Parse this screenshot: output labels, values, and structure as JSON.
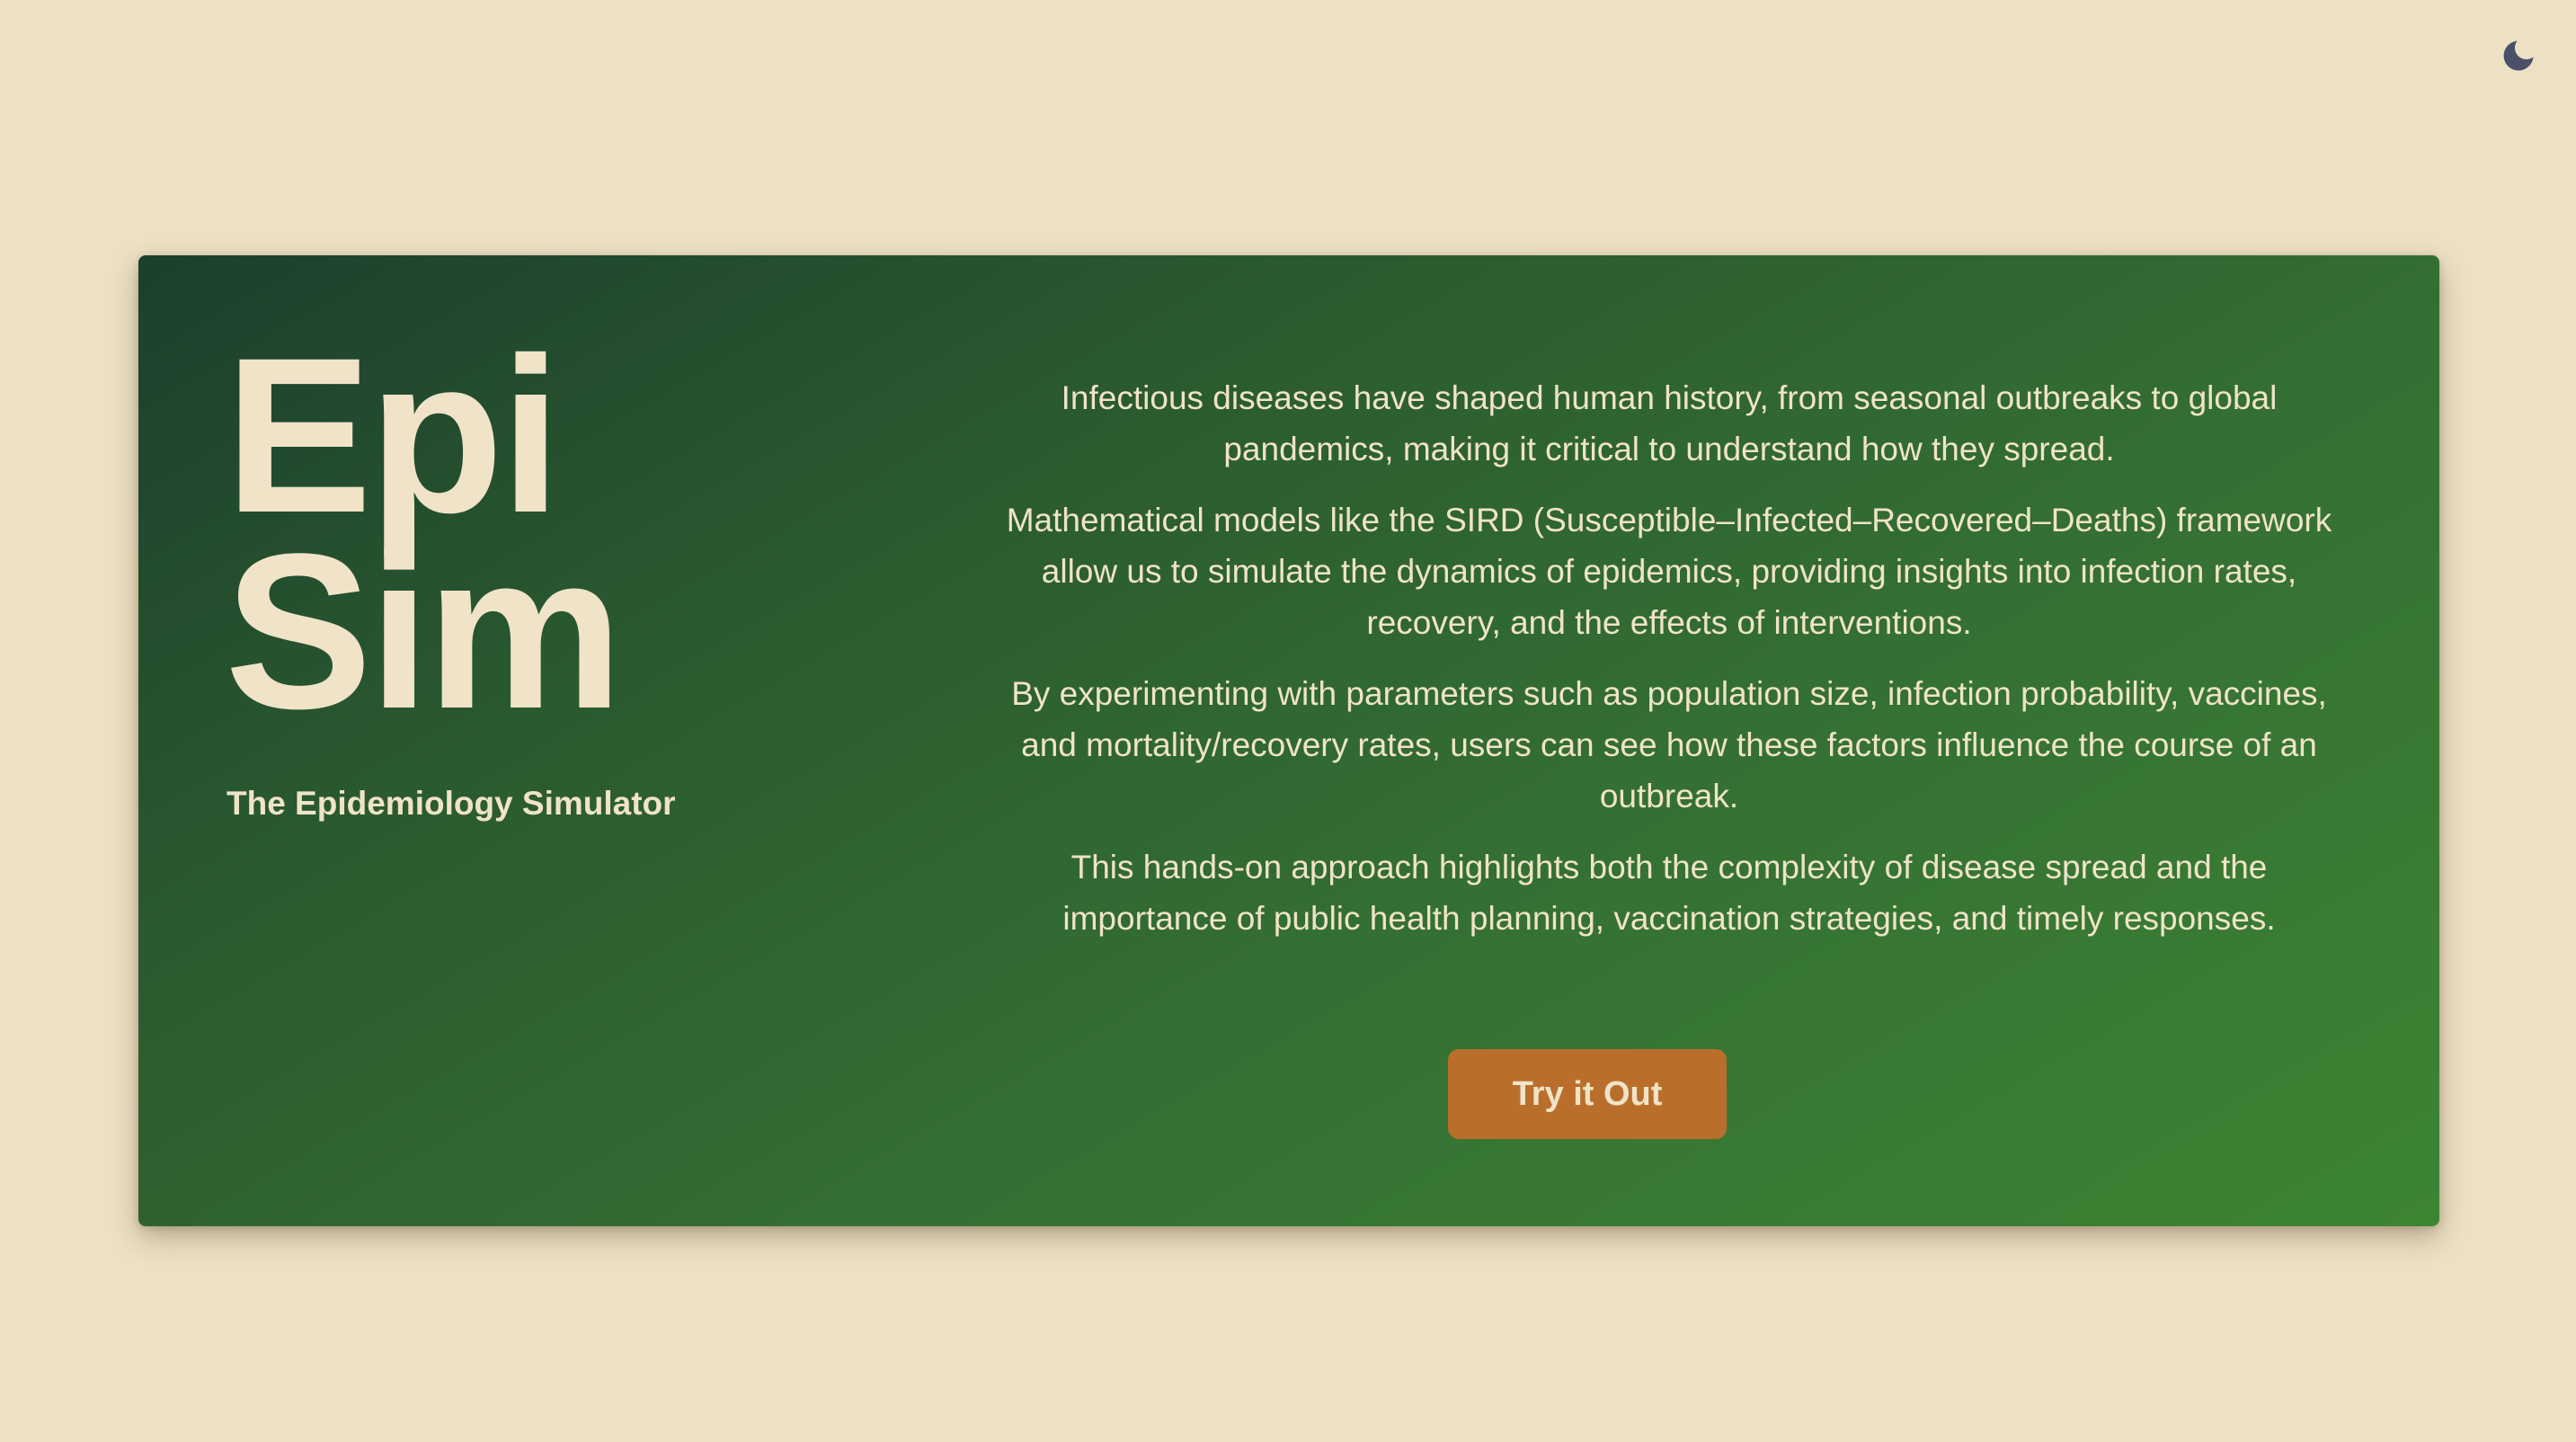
{
  "theme_toggle": {
    "icon": "moon-icon",
    "color": "#4a5068"
  },
  "hero": {
    "title_line_1": "Epi",
    "title_line_2": "Sim",
    "subtitle": "The Epidemiology Simulator",
    "paragraphs": [
      "Infectious diseases have shaped human history, from seasonal outbreaks to global pandemics, making it critical to understand how they spread.",
      "Mathematical models like the SIRD (Susceptible–Infected–Recovered–Deaths) framework allow us to simulate the dynamics of epidemics, providing insights into infection rates, recovery, and the effects of interventions.",
      "By experimenting with parameters such as population size, infection probability, vaccines, and mortality/recovery rates, users can see how these factors influence the course of an outbreak.",
      "This hands-on approach highlights both the complexity of disease spread and the importance of public health planning, vaccination strategies, and timely responses."
    ],
    "cta_label": "Try it Out"
  },
  "colors": {
    "page_background": "#ede0c4",
    "card_gradient_start": "#1c3f2c",
    "card_gradient_end": "#3d8433",
    "text": "#f0e3c8",
    "accent": "#b96f2b"
  }
}
